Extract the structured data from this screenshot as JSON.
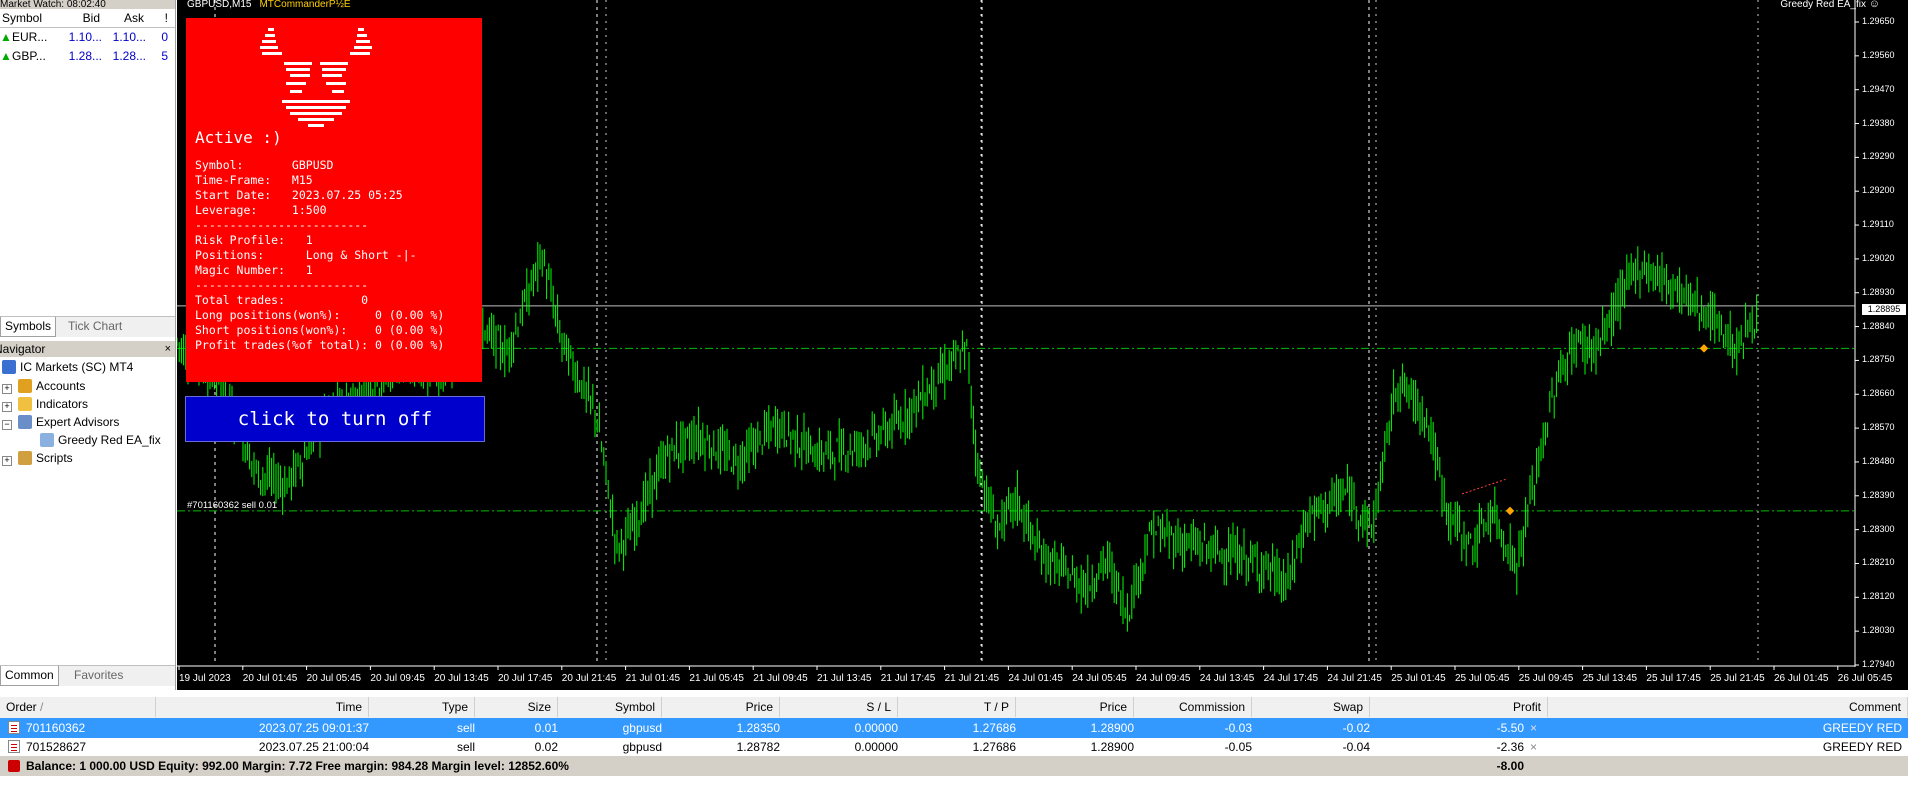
{
  "market_watch": {
    "title": "Market Watch: 08:02:40",
    "headers": {
      "symbol": "Symbol",
      "bid": "Bid",
      "ask": "Ask",
      "excl": "!"
    },
    "rows": [
      {
        "symbol": "EUR...",
        "bid": "1.10...",
        "ask": "1.10...",
        "spread": "0"
      },
      {
        "symbol": "GBP...",
        "bid": "1.28...",
        "ask": "1.28...",
        "spread": "5"
      }
    ],
    "tabs": [
      "Symbols",
      "Tick Chart"
    ]
  },
  "navigator": {
    "title": "Navigator",
    "items": [
      "IC Markets (SC) MT4",
      "Accounts",
      "Indicators",
      "Expert Advisors",
      "Greedy Red EA_fix",
      "Scripts"
    ],
    "tabs": [
      "Common",
      "Favorites"
    ]
  },
  "chart": {
    "title": "GBPUSD,M15",
    "indicator": "MTCommanderP½E",
    "ea_name": "Greedy Red EA_fix",
    "current_price": "1.28895",
    "order_label": "#701160362 sell 0.01",
    "price_labels": [
      "1.29650",
      "1.29560",
      "1.29470",
      "1.29380",
      "1.29290",
      "1.29200",
      "1.29110",
      "1.29020",
      "1.28930",
      "1.28840",
      "1.28750",
      "1.28660",
      "1.28570",
      "1.28480",
      "1.28390",
      "1.28300",
      "1.28210",
      "1.28120",
      "1.28030",
      "1.27940"
    ],
    "time_labels": [
      "19 Jul 2023",
      "20 Jul 01:45",
      "20 Jul 05:45",
      "20 Jul 09:45",
      "20 Jul 13:45",
      "20 Jul 17:45",
      "20 Jul 21:45",
      "21 Jul 01:45",
      "21 Jul 05:45",
      "21 Jul 09:45",
      "21 Jul 13:45",
      "21 Jul 17:45",
      "21 Jul 21:45",
      "24 Jul 01:45",
      "24 Jul 05:45",
      "24 Jul 09:45",
      "24 Jul 13:45",
      "24 Jul 17:45",
      "24 Jul 21:45",
      "25 Jul 01:45",
      "25 Jul 05:45",
      "25 Jul 09:45",
      "25 Jul 13:45",
      "25 Jul 17:45",
      "25 Jul 21:45",
      "26 Jul 01:45",
      "26 Jul 05:45"
    ],
    "colors": {
      "candle": "#00ff00",
      "background": "#000000",
      "grid": "#ffffff",
      "level_line": "#00c000"
    }
  },
  "ea_panel": {
    "status": "Active :)",
    "lines": [
      "Symbol:       GBPUSD",
      "Time-Frame:   M15",
      "Start Date:   2023.07.25 05:25",
      "Leverage:     1:500",
      "-------------------------",
      "Risk Profile:   1",
      "Positions:      Long & Short -|-",
      "Magic Number:   1",
      "-------------------------",
      "Total trades:           0",
      "Long positions(won%):     0 (0.00 %)",
      "Short positions(won%):    0 (0.00 %)",
      "Profit trades(%of total): 0 (0.00 %)"
    ],
    "button": "click to turn off",
    "color": "#ff0000"
  },
  "terminal": {
    "headers": [
      "Order",
      "Time",
      "Type",
      "Size",
      "Symbol",
      "Price",
      "S / L",
      "T / P",
      "Price",
      "Commission",
      "Swap",
      "Profit",
      "Comment"
    ],
    "orders": [
      {
        "order": "701160362",
        "time": "2023.07.25 09:01:37",
        "type": "sell",
        "size": "0.01",
        "symbol": "gbpusd",
        "price": "1.28350",
        "sl": "0.00000",
        "tp": "1.27686",
        "cur_price": "1.28900",
        "commission": "-0.03",
        "swap": "-0.02",
        "profit": "-5.50",
        "comment": "GREEDY RED"
      },
      {
        "order": "701528627",
        "time": "2023.07.25 21:00:04",
        "type": "sell",
        "size": "0.02",
        "symbol": "gbpusd",
        "price": "1.28782",
        "sl": "0.00000",
        "tp": "1.27686",
        "cur_price": "1.28900",
        "commission": "-0.05",
        "swap": "-0.04",
        "profit": "-2.36",
        "comment": "GREEDY RED"
      }
    ],
    "balance_line": "Balance: 1 000.00 USD  Equity: 992.00  Margin: 7.72  Free margin: 984.28  Margin level: 12852.60%",
    "total_profit": "-8.00"
  }
}
